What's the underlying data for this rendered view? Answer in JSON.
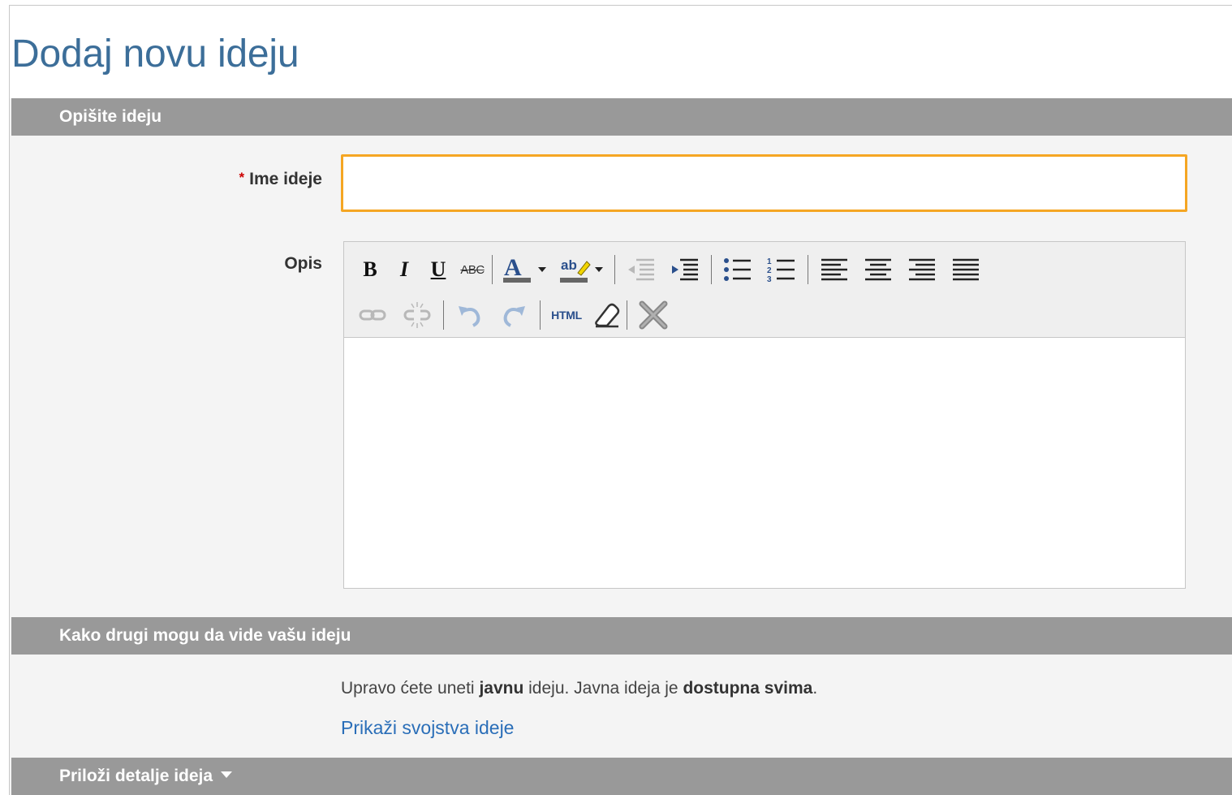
{
  "page": {
    "title": "Dodaj novu ideju"
  },
  "sections": {
    "describe": {
      "title": "Opišite ideju"
    },
    "visibility": {
      "title": "Kako drugi mogu da vide vašu ideju"
    },
    "attach": {
      "title": "Priloži detalje ideja"
    }
  },
  "form": {
    "name": {
      "required_mark": "*",
      "label": "Ime ideje",
      "value": "",
      "placeholder": ""
    },
    "description": {
      "label": "Opis"
    }
  },
  "toolbar": {
    "bold": "B",
    "italic": "I",
    "underline": "U",
    "strikethrough": "ABC",
    "html": "HTML",
    "row1_icons": [
      "bold-icon",
      "italic-icon",
      "underline-icon",
      "strikethrough-icon",
      "font-color-icon",
      "highlight-color-icon",
      "outdent-icon",
      "indent-icon",
      "bulleted-list-icon",
      "numbered-list-icon",
      "align-left-icon",
      "align-center-icon",
      "align-right-icon",
      "align-justify-icon"
    ],
    "row2_icons": [
      "link-icon",
      "unlink-icon",
      "undo-icon",
      "redo-icon",
      "html-source-icon",
      "eraser-icon",
      "remove-format-icon"
    ],
    "colors": {
      "font_color_bar": "#666666",
      "icon_blue": "#2a4f8c",
      "highlight": "#f2d500"
    }
  },
  "visibility": {
    "text_before": "Upravo ćete uneti ",
    "bold1": "javnu",
    "text_middle": " ideju. Javna ideja je ",
    "bold2": "dostupna svima",
    "text_after": ".",
    "link_label": "Prikaži svojstva ideje"
  },
  "colors": {
    "title": "#3c6e99",
    "section_header": "#999999",
    "input_focus_border": "#f5a623",
    "link": "#2a6eb8",
    "required": "#cc0000"
  }
}
